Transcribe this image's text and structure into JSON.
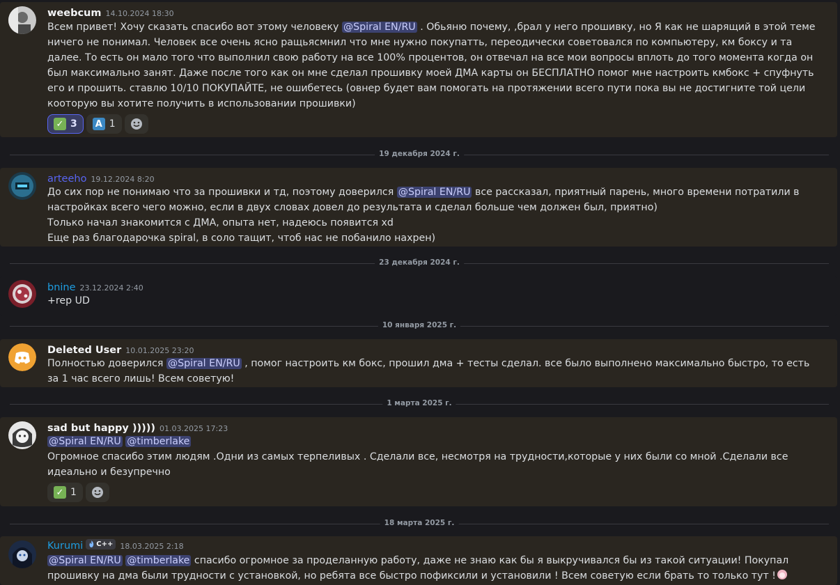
{
  "messages": {
    "m1": {
      "username": "weebcum",
      "timestamp": "14.10.2024 18:30",
      "text_a": "Всем привет! Хочу сказать спасибо вот этому человеку ",
      "mention": "@Spiral EN/RU",
      "text_b": " . Обьяню почему, ,брал у него прошивку, но Я как не шарящий в этой теме ничего не понимал. Человек все очень ясно ращьясмнил что мне нужно покупатть, переодически советовался по компьютеру, км боксу и та далее. То есть он мало того что выполнил свою работу на все 100% процентов, он отвечал на все мои вопросы вплоть до того момента когда он был максимально занят. Даже после того как он мне сделал прошивку моей ДМА карты он БЕСПЛАТНО помог мне настроить кмбокс + спуфнуть его и прошить. ставлю 10/10 ПОКУПАЙТЕ, не ошибетесь (овнер будет вам помогать на протяжении всего пути пока вы не достигните той цели кооторую вы хотите получить в использовании прошивки)",
      "reactions": [
        {
          "emoji": "✓",
          "count": "3"
        },
        {
          "emoji": "A",
          "count": "1"
        }
      ]
    },
    "m2": {
      "username": "arteeho",
      "username_color": "#5865f2",
      "timestamp": "19.12.2024 8:20",
      "text_a": "До сих пор не понимаю что за прошивки и тд, поэтому доверился ",
      "mention": "@Spiral EN/RU",
      "text_b": " все рассказал, приятный парень, много времени потратили в настройках всего чего можно, если в двух словах довел до результата и сделал больше чем должен был, приятно)",
      "line2": "Только начал знакомится с ДМА, опыта нет, надеюсь появится xd",
      "line3": "Еще раз благодарочка spiral, в соло тащит, чтоб нас не побанило нахрен)"
    },
    "m3": {
      "username": "bnine",
      "username_color": "#1e9de0",
      "timestamp": "23.12.2024 2:40",
      "text": "+rep UD"
    },
    "m4": {
      "username": "Deleted User",
      "timestamp": "10.01.2025 23:20",
      "text_a": "Полностью доверился ",
      "mention": "@Spiral EN/RU",
      "text_b": " , помог настроить км бокс, прошил дма + тесты сделал. все было выполнено максимально быстро, то есть за 1 час всего лишь! Всем советую!"
    },
    "m5": {
      "username": "sad but happy )))))",
      "timestamp": "01.03.2025 17:23",
      "mention1": "@Spiral EN/RU",
      "mention2": "@timberlake",
      "text": "Огромное спасибо этим людям .Одни из самых терпеливых . Сделали все, несмотря на трудности,которые у них были со мной .Сделали все идеально и безупречно",
      "reactions": [
        {
          "emoji": "✓",
          "count": "1"
        }
      ]
    },
    "m6": {
      "username": "Kurumi",
      "username_color": "#1e9de0",
      "badge": "C++",
      "timestamp": "18.03.2025 2:18",
      "mention1": "@Spiral EN/RU",
      "mention2": "@timberlake",
      "text": " спасибо огромное за проделанную работу, даже не знаю как бы я выкручивался бы из такой ситуации!  Покупал прошивку на дма были трудности с установкой, но ребята все быстро пофиксили и установили ! Всем советую если брать то только тут !"
    }
  },
  "dividers": {
    "d1": "19 декабря 2024 г.",
    "d2": "23 декабря 2024 г.",
    "d3": "10 января 2025 г.",
    "d4": "1 марта 2025 г.",
    "d5": "18 марта 2025 г."
  },
  "colors": {
    "message_bg": "#2a2620",
    "mention_bg": "#3c4270",
    "accent": "#5865f2",
    "discord_orange": "#f0a232"
  },
  "icons": {
    "check_emoji": "white-check-mark",
    "a_emoji": "regional-indicator-a",
    "add_reaction": "add-reaction-smiley"
  }
}
